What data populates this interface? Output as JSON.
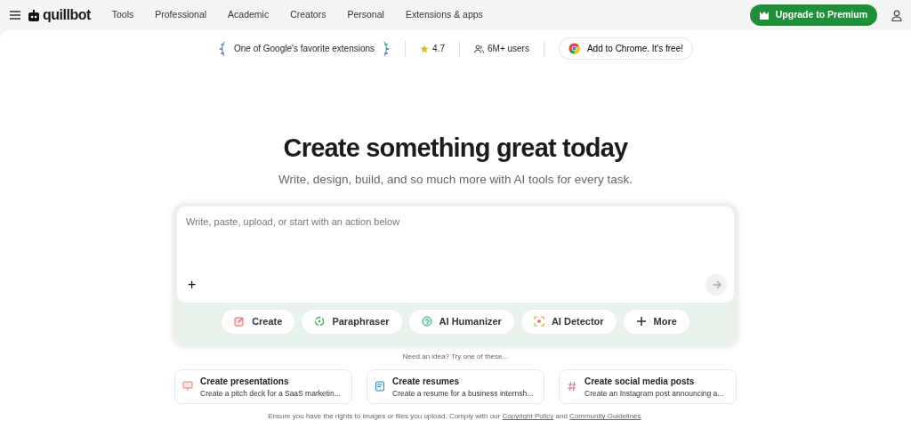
{
  "nav": {
    "logo": "quillbot",
    "links": [
      "Tools",
      "Professional",
      "Academic",
      "Creators",
      "Personal",
      "Extensions & apps"
    ],
    "premium": "Upgrade to Premium"
  },
  "promo": {
    "award": "One of Google's favorite extensions",
    "rating": "4.7",
    "users": "6M+ users",
    "chrome": "Add to Chrome. It's free!"
  },
  "hero": {
    "title": "Create something great today",
    "subtitle": "Write, design, build, and so much more with AI tools for every task."
  },
  "editor": {
    "placeholder": "Write, paste, upload, or start with an action below",
    "add": "+"
  },
  "tools": [
    {
      "kind": "create",
      "label": "Create"
    },
    {
      "kind": "paraphraser",
      "label": "Paraphraser"
    },
    {
      "kind": "humanizer",
      "label": "AI Humanizer"
    },
    {
      "kind": "detector",
      "label": "AI Detector"
    },
    {
      "kind": "more",
      "label": "More"
    }
  ],
  "hint": "Need an idea? Try one of these...",
  "suggestions": [
    {
      "kind": "presentation",
      "title": "Create presentations",
      "text": "Create a pitch deck for a SaaS marketin..."
    },
    {
      "kind": "resume",
      "title": "Create resumes",
      "text": "Create a resume for a business internsh..."
    },
    {
      "kind": "social",
      "title": "Create social media posts",
      "text": "Create an Instagram post announcing a..."
    }
  ],
  "footer": [
    {
      "kind": "text",
      "text": "Ensure you have the rights to images or files you upload. Comply with our "
    },
    {
      "kind": "link",
      "text": "Copyright Policy"
    },
    {
      "kind": "text",
      "text": " and "
    },
    {
      "kind": "link",
      "text": "Community Guidelines"
    },
    {
      "kind": "text",
      "text": "."
    }
  ]
}
